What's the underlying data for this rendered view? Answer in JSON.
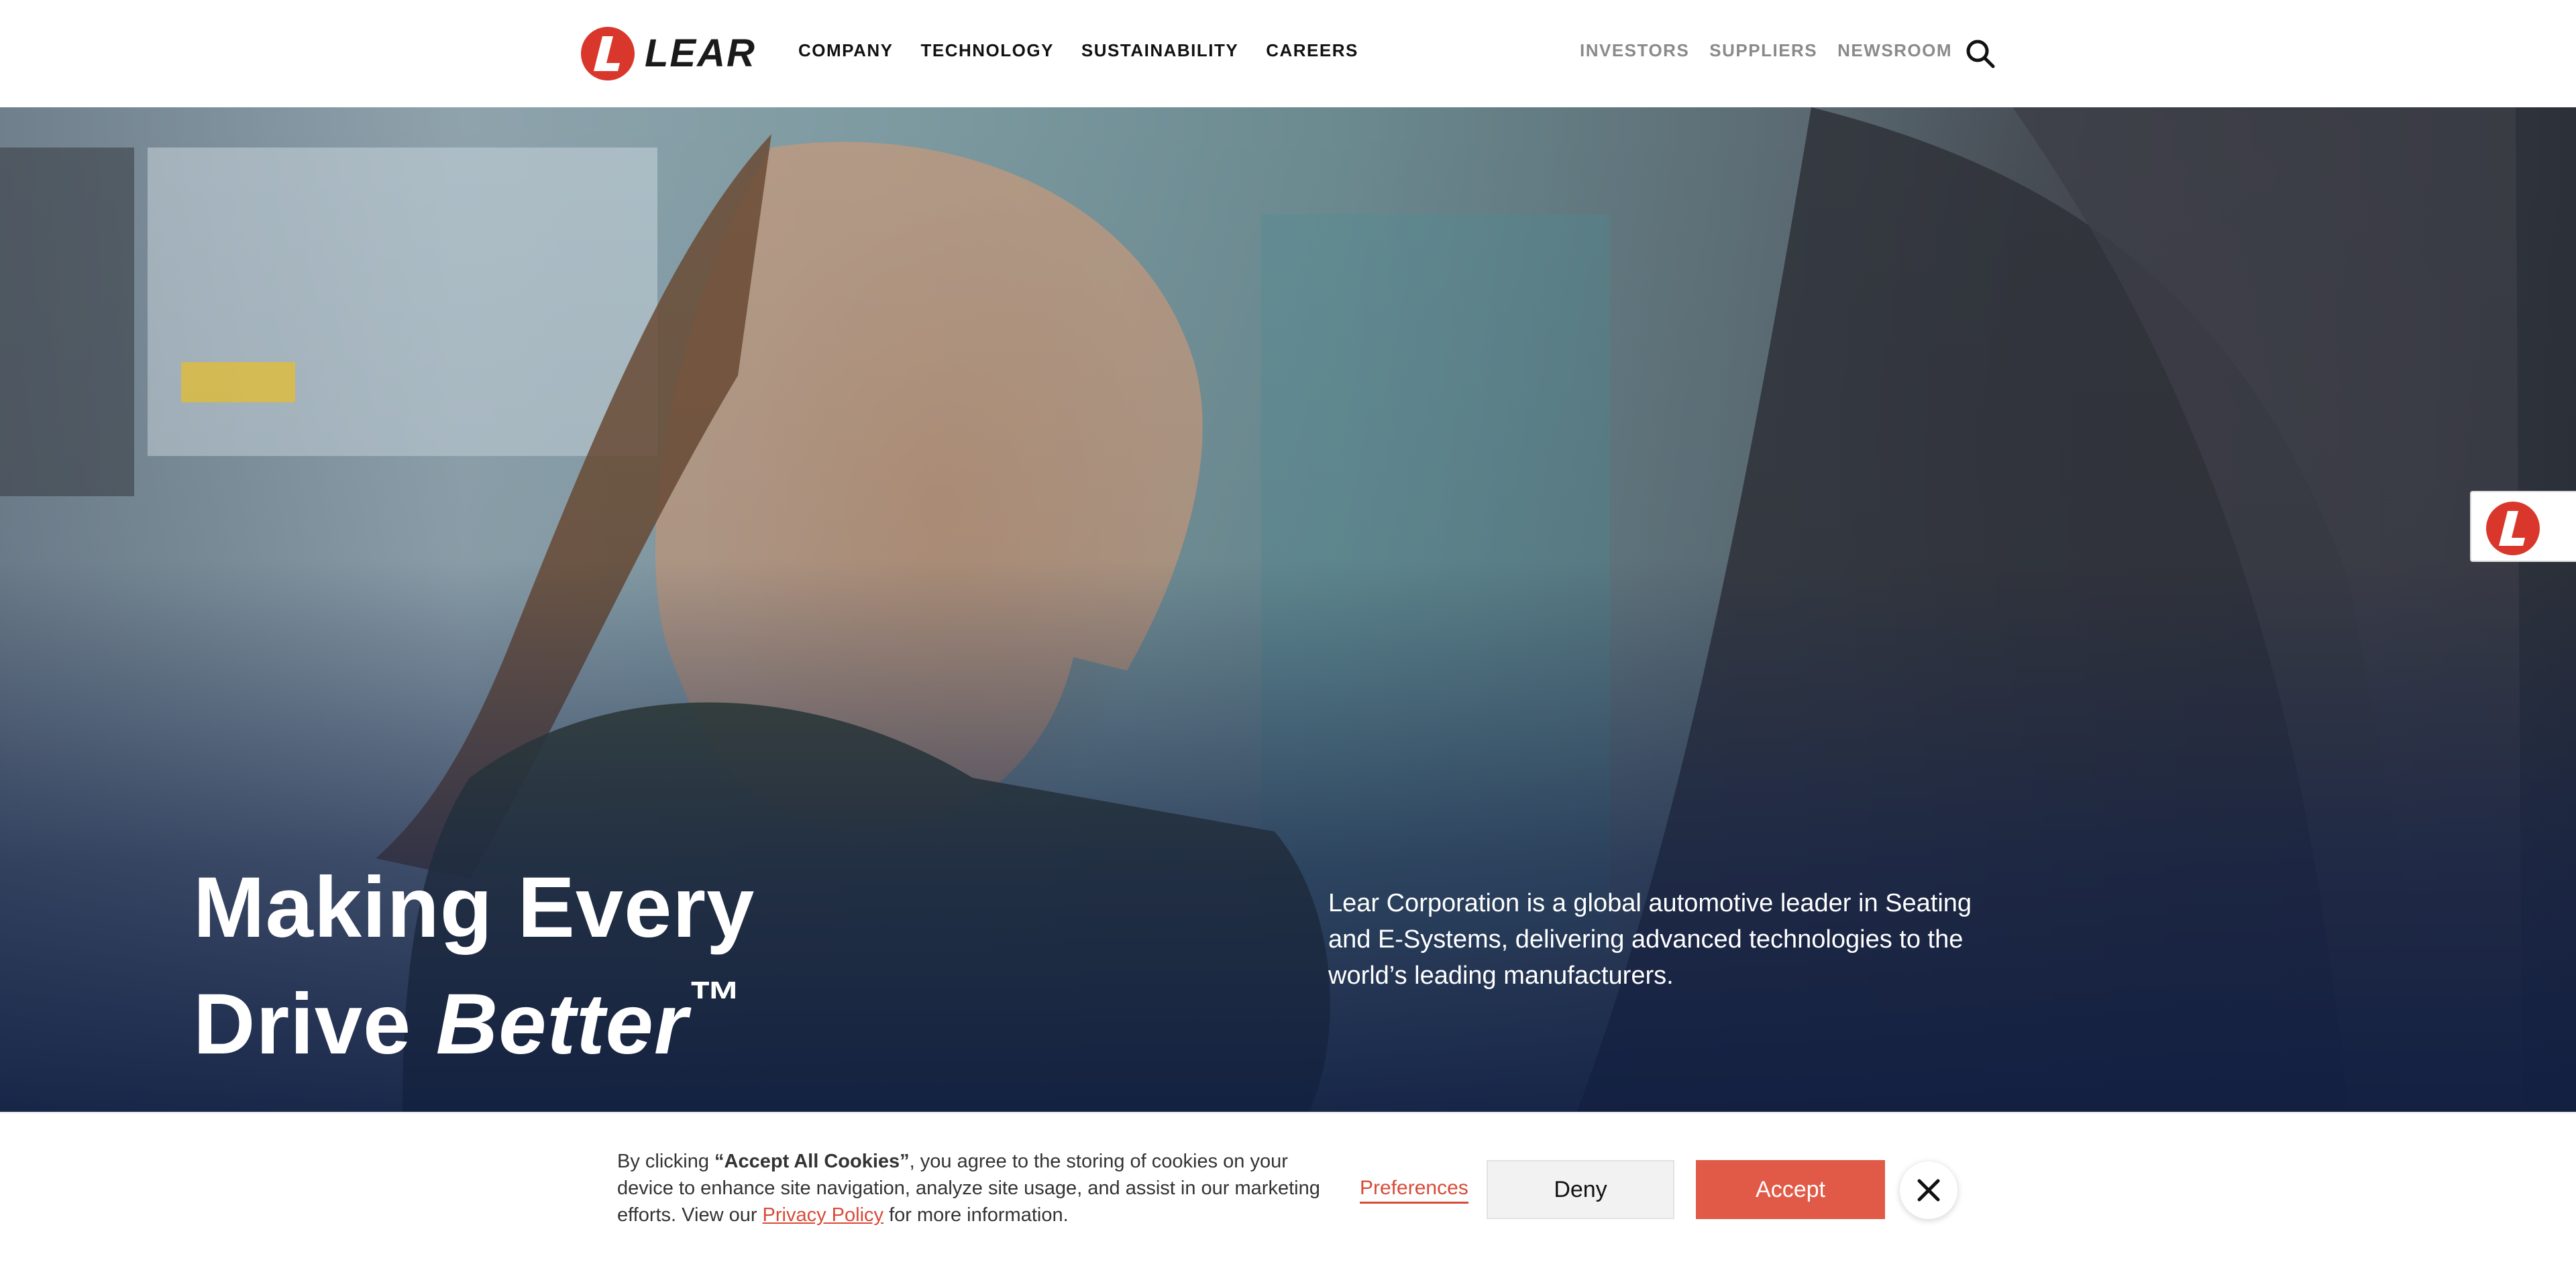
{
  "header": {
    "logo_text": "LEAR",
    "logo_mark_letter": "L",
    "brand_color": "#d9372b",
    "nav_main": [
      "COMPANY",
      "TECHNOLOGY",
      "SUSTAINABILITY",
      "CAREERS"
    ],
    "nav_utility": [
      "INVESTORS",
      "SUPPLIERS",
      "NEWSROOM"
    ],
    "search_icon": "search-icon"
  },
  "hero": {
    "title_line1": "Making Every",
    "title_line2_prefix": "Drive ",
    "title_line2_emphasis": "Better",
    "title_trademark": "™",
    "description": "Lear Corporation is a global automotive leader in Seating and E-Systems, delivering advanced technologies to the world’s leading manufacturers.",
    "side_badge_letter": "L"
  },
  "cookie_banner": {
    "text_before": "By clicking ",
    "text_bold": "“Accept All Cookies”",
    "text_after": ", you agree to the storing of cookies on your device to enhance site navigation, analyze site usage, and assist in our marketing efforts. View our ",
    "privacy_link": "Privacy Policy",
    "text_end": " for more information.",
    "preferences_label": "Preferences",
    "deny_label": "Deny",
    "accept_label": "Accept",
    "close_icon": "close-icon",
    "accent_color": "#e05a47"
  }
}
